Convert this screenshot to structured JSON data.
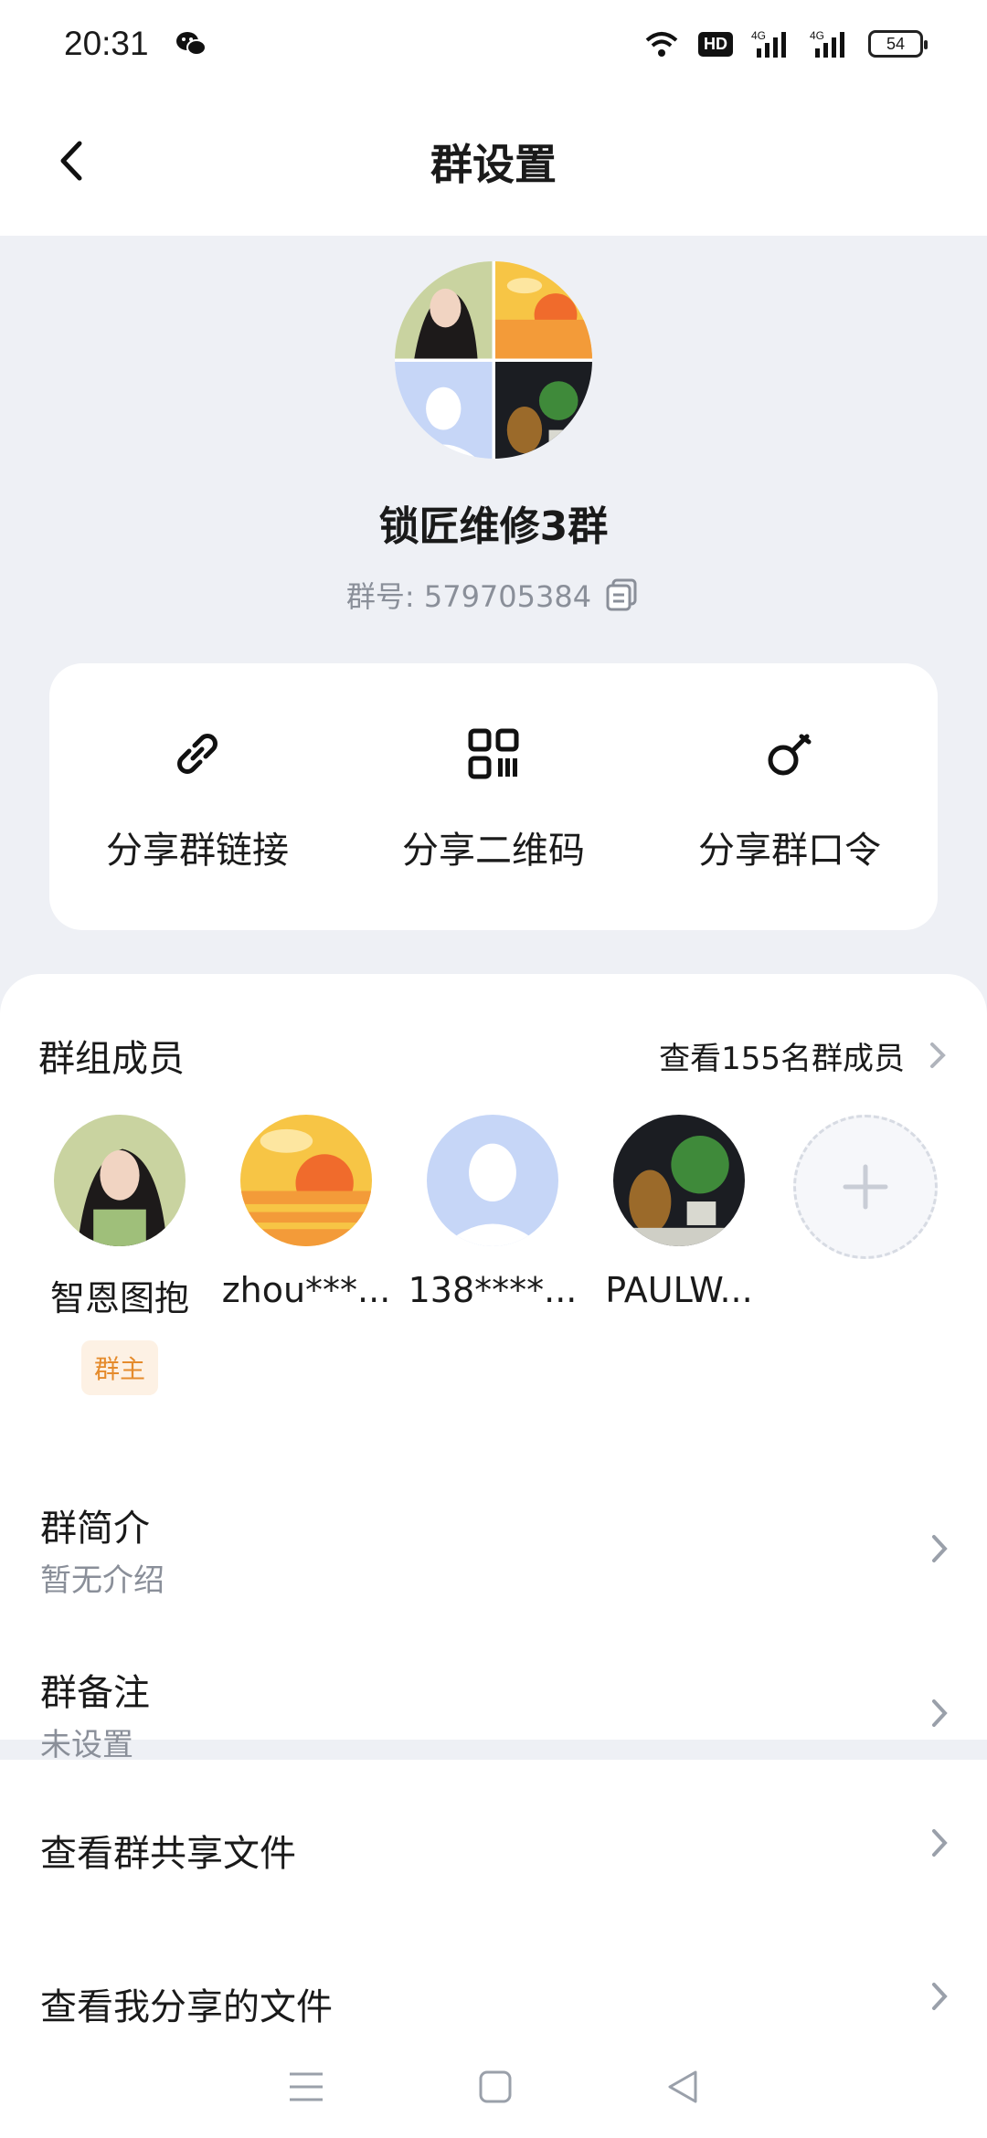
{
  "status": {
    "time": "20:31",
    "hd": "HD",
    "battery": "54",
    "net1": "4G",
    "net2": "4G"
  },
  "nav": {
    "title": "群设置"
  },
  "group": {
    "name": "锁匠维修3群",
    "id_label": "群号: 579705384"
  },
  "share": [
    {
      "label": "分享群链接",
      "icon": "link-icon"
    },
    {
      "label": "分享二维码",
      "icon": "qrcode-icon"
    },
    {
      "label": "分享群口令",
      "icon": "key-icon"
    }
  ],
  "members": {
    "title": "群组成员",
    "view_all": "查看155名群成员",
    "list": [
      {
        "name": "智恩图抱",
        "badge": "群主"
      },
      {
        "name": "zhou***..."
      },
      {
        "name": "138****..."
      },
      {
        "name": "PAULW..."
      }
    ]
  },
  "rows": {
    "intro": {
      "label": "群简介",
      "value": "暂无介绍"
    },
    "remark": {
      "label": "群备注",
      "value": "未设置"
    },
    "shared_files": {
      "label": "查看群共享文件"
    },
    "my_files": {
      "label": "查看我分享的文件"
    }
  },
  "colors": {
    "accent_orange": "#e58b2c",
    "bg": "#eef0f5",
    "muted": "#8a8f99"
  }
}
